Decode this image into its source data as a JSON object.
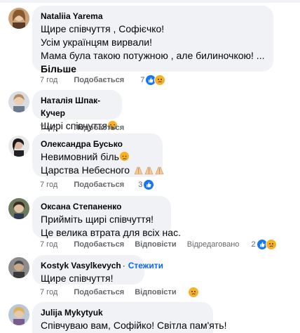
{
  "colors": {
    "bubble": "#f0f2f5",
    "link": "#0866ff",
    "like": "#1877f2",
    "sad": "#f7b125",
    "meta": "#65676b"
  },
  "actions_labels": {
    "like": "Подобається",
    "reply": "Відповісти",
    "edited": "Відредаговано"
  },
  "comments": [
    {
      "author": "Nataliia Yarema",
      "lines": [
        "Щире співчуття , Софієчко!",
        "Усім українцям вирвали!",
        "Мама була такою потужною , але билиночкою! ..."
      ],
      "more": "Більше",
      "time": "7 год",
      "reactions": "7",
      "reaction_icons": [
        "like-icon",
        "sad-icon"
      ]
    },
    {
      "author": "Наталія Шпак-Кучер",
      "lines": [
        "Щирі співчуття"
      ],
      "emoji": "crying-face-icon",
      "time": "7 год"
    },
    {
      "author": "Олександра Бусько",
      "lines": [
        "Невимовний біль",
        "Царства Небесного"
      ],
      "time": "7 год",
      "reactions": "3",
      "reaction_icons": [
        "like-icon"
      ]
    },
    {
      "author": "Оксана Степаненко",
      "lines": [
        "Прийміть щирі співчуття!",
        "Це велика втрата для всіх нас."
      ],
      "time": "7 год",
      "edited": true,
      "reactions": "2",
      "reaction_icons": [
        "like-icon",
        "sad-icon"
      ]
    },
    {
      "author": "Kostyk Vasylkevych",
      "follow": "Стежити",
      "lines": [
        "Щире співчуття!"
      ],
      "time": "7 год",
      "reaction_icons": [
        "sad-icon"
      ]
    },
    {
      "author": "Julija Mykytyuk",
      "lines": [
        "Співчуваю вам, Софійко! Світла пам'ять!"
      ]
    }
  ]
}
